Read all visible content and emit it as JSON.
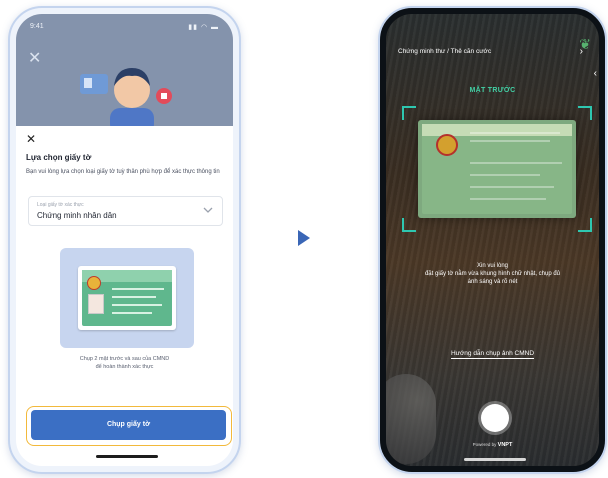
{
  "left_phone": {
    "status_time": "9:41",
    "status_icons": "▮▮ ◠ ▬",
    "icons": {
      "close": "close-icon",
      "chevron": "chevron-down-icon"
    },
    "sheet": {
      "title": "Lựa chọn giấy tờ",
      "description": "Bạn vui lòng lựa chọn loại giấy tờ tuỳ thân phù hợp để xác thực thông tin",
      "select_label": "Loại giấy tờ xác thực",
      "select_value": "Chứng minh nhân dân",
      "panel_caption_1": "Chụp 2 mặt trước và sau của CMND",
      "panel_caption_2": "để hoàn thành xác thực",
      "cta": "Chụp giấy tờ"
    }
  },
  "right_phone": {
    "title": "Chứng minh thư / Thẻ căn cước",
    "side": "MẶT TRƯỚC",
    "hint_line_1": "Xin vui lòng",
    "hint_line_2": "đặt giấy tờ nằm vừa khung hình chữ nhật, chụp đủ",
    "hint_line_3": "ánh sáng và rõ nét",
    "guide_link": "Hướng dẫn chụp ảnh CMND",
    "powered_by": "Powered by",
    "brand": "VNPT"
  },
  "colors": {
    "primary_button": "#3b6fc4",
    "highlight": "#f2b93b",
    "scan_accent": "#2ec7b0",
    "arrow": "#3a66b6"
  }
}
